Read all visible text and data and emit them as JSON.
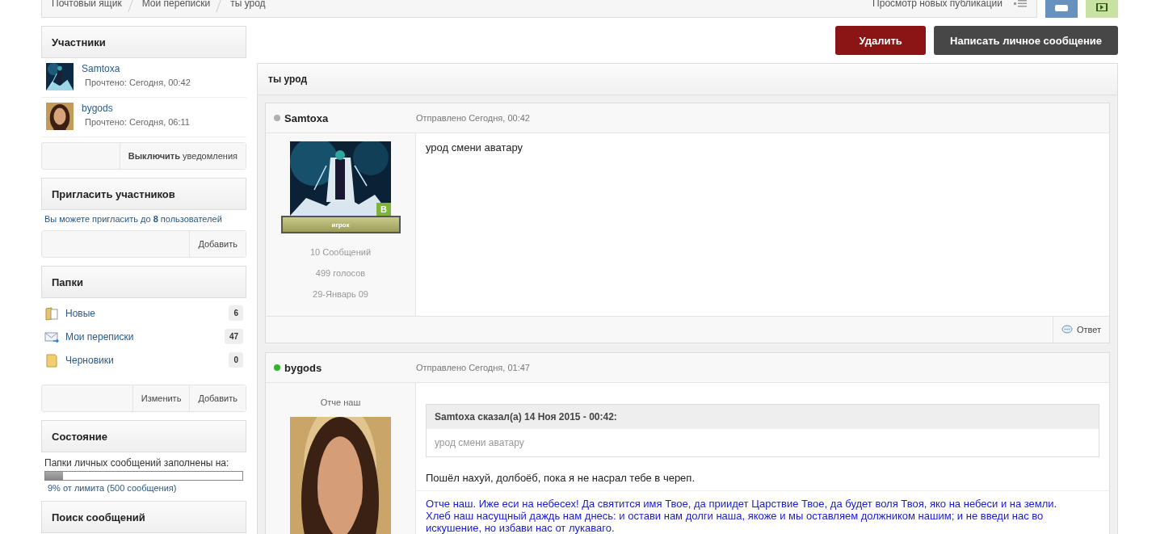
{
  "breadcrumbs": [
    "Почтовый ящик",
    "Мои переписки",
    "ты урод"
  ],
  "new_posts_link": "Просмотр новых публикаций",
  "participants": {
    "title": "Участники",
    "members": [
      {
        "name": "Samtoxa",
        "read": "Прочтено: Сегодня, 00:42"
      },
      {
        "name": "bygods",
        "read": "Прочтено: Сегодня, 06:11"
      }
    ]
  },
  "notify_button": "**Выключить** уведомления",
  "invite": {
    "title": "Пригласить участников",
    "note": "Вы можете пригласить до **8** пользователей",
    "button": "Добавить"
  },
  "folders": {
    "title": "Папки",
    "items": [
      {
        "kind": "new",
        "name": "Новые",
        "count": "6"
      },
      {
        "kind": "mail",
        "name": "Мои переписки",
        "count": "47"
      },
      {
        "kind": "drafts",
        "name": "Черновики",
        "count": "0"
      }
    ],
    "buttons": [
      "Изменить",
      "Добавить"
    ]
  },
  "status": {
    "title": "Состояние",
    "label": "Папки личных сообщений заполнены на:",
    "level": 0.09,
    "note": "9% от лимита (500 сообщения)"
  },
  "search": {
    "title": "Поиск сообщений"
  },
  "actions": [
    {
      "kind": "danger",
      "label": "Удалить"
    },
    {
      "kind": "dark",
      "label": "Написать личное сообщение"
    }
  ],
  "topic": {
    "title": "ты урод"
  },
  "posts": [
    {
      "author": "Samtoxa",
      "online": false,
      "sent": "Отправлено Сегодня, 00:42",
      "group_letter": "В",
      "rank": "игрок",
      "stats": [
        "10 Сообщений",
        "499 голосов",
        "29-Январь 09"
      ],
      "body": "урод смени аватару",
      "reply": "Ответ"
    },
    {
      "author": "bygods",
      "online": true,
      "sent": "Отправлено Сегодня, 01:47",
      "user_title": "Отче наш",
      "quote": {
        "header": "Samtoxa сказал(а) 14 Ноя 2015 - 00:42:",
        "text": "урод смени аватару"
      },
      "body": "Пошёл нахуй, долбоёб, пока я не насрал тебе в череп.",
      "signature": [
        "Отче наш. Иже еси на небесех! Да святится имя Твое, да приидет Царствие Твое, да будет воля Твоя, яко на небеси и на земли.",
        "Хлеб наш насущный даждь нам днесь: и остави нам долги наша, якоже и мы оставляем должником нашим; и не введи нас во искушение, но избави нас от лукаваго."
      ]
    }
  ]
}
